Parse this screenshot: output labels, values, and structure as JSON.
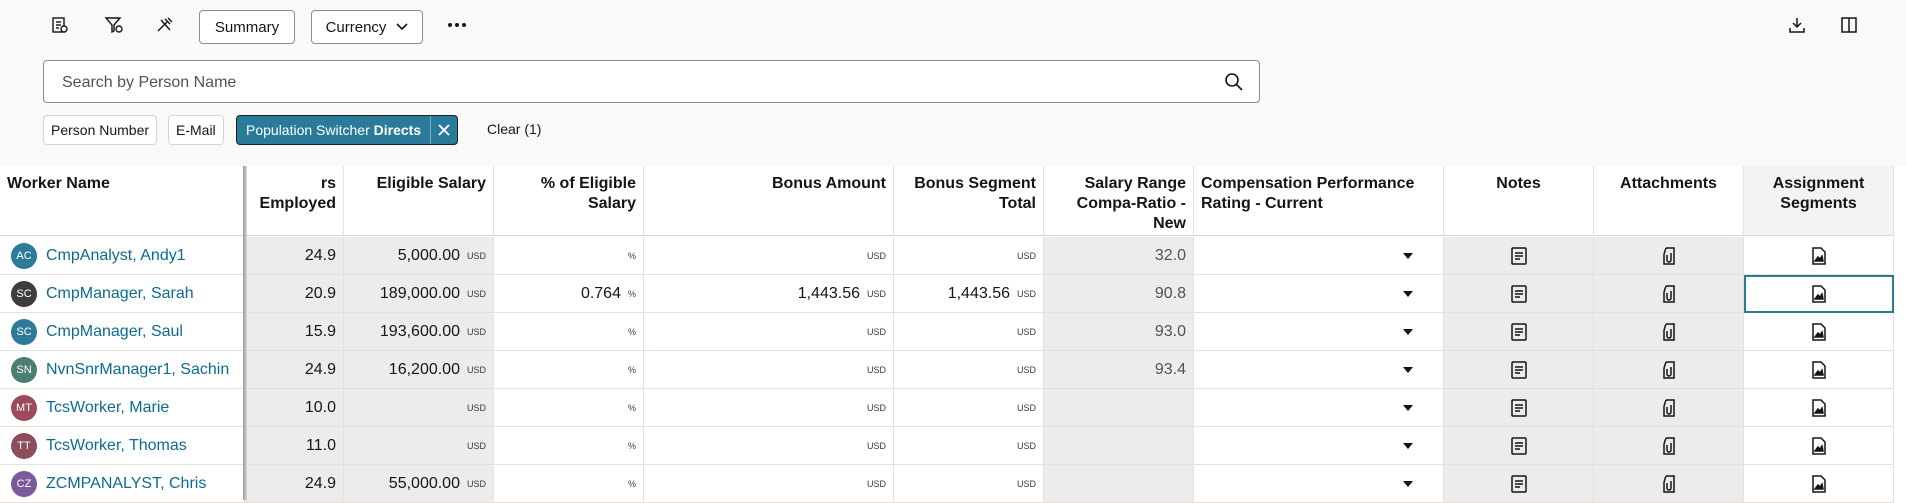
{
  "toolbar": {
    "summary_label": "Summary",
    "currency_label": "Currency",
    "icons": [
      "report-icon",
      "filter-icon",
      "tools-icon",
      "more-icon",
      "download-icon",
      "split-view-icon"
    ]
  },
  "search": {
    "placeholder": "Search by Person Name"
  },
  "filters": {
    "chips": [
      "Person Number",
      "E-Mail"
    ],
    "active_chip": {
      "prefix": "Population Switcher",
      "value": "Directs"
    },
    "clear_label": "Clear (1)"
  },
  "columns": {
    "worker_name": "Worker Name",
    "years_employed": "rs Employed",
    "eligible_salary": "Eligible Salary",
    "pct_eligible": "% of Eligible Salary",
    "bonus_amount": "Bonus Amount",
    "bonus_segment": "Bonus Segment Total",
    "compa_ratio": "Salary Range Compa-Ratio - New",
    "perf_rating": "Compensation Performance Rating - Current",
    "notes": "Notes",
    "attachments": "Attachments",
    "segments": "Assignment Segments"
  },
  "currency_code": "USD",
  "pct_symbol": "%",
  "rows": [
    {
      "initials": "AC",
      "avatar_color": "#2e7a9a",
      "name": "CmpAnalyst, Andy1",
      "years": "24.9",
      "salary": "5,000.00",
      "pct": "",
      "bonus": "",
      "segment": "",
      "compa": "32.0"
    },
    {
      "initials": "SC",
      "avatar_color": "#3d3d3d",
      "name": "CmpManager, Sarah",
      "years": "20.9",
      "salary": "189,000.00",
      "pct": "0.764",
      "bonus": "1,443.56",
      "segment": "1,443.56",
      "compa": "90.8"
    },
    {
      "initials": "SC",
      "avatar_color": "#2e7a9a",
      "name": "CmpManager, Saul",
      "years": "15.9",
      "salary": "193,600.00",
      "pct": "",
      "bonus": "",
      "segment": "",
      "compa": "93.0"
    },
    {
      "initials": "SN",
      "avatar_color": "#4b7f73",
      "name": "NvnSnrManager1, Sachin",
      "years": "24.9",
      "salary": "16,200.00",
      "pct": "",
      "bonus": "",
      "segment": "",
      "compa": "93.4"
    },
    {
      "initials": "MT",
      "avatar_color": "#9a4a5a",
      "name": "TcsWorker, Marie",
      "years": "10.0",
      "salary": "",
      "pct": "",
      "bonus": "",
      "segment": "",
      "compa": ""
    },
    {
      "initials": "TT",
      "avatar_color": "#8a4f5a",
      "name": "TcsWorker, Thomas",
      "years": "11.0",
      "salary": "",
      "pct": "",
      "bonus": "",
      "segment": "",
      "compa": ""
    },
    {
      "initials": "CZ",
      "avatar_color": "#7a5a9a",
      "name": "ZCMPANALYST, Chris",
      "years": "24.9",
      "salary": "55,000.00",
      "pct": "",
      "bonus": "",
      "segment": "",
      "compa": ""
    }
  ]
}
